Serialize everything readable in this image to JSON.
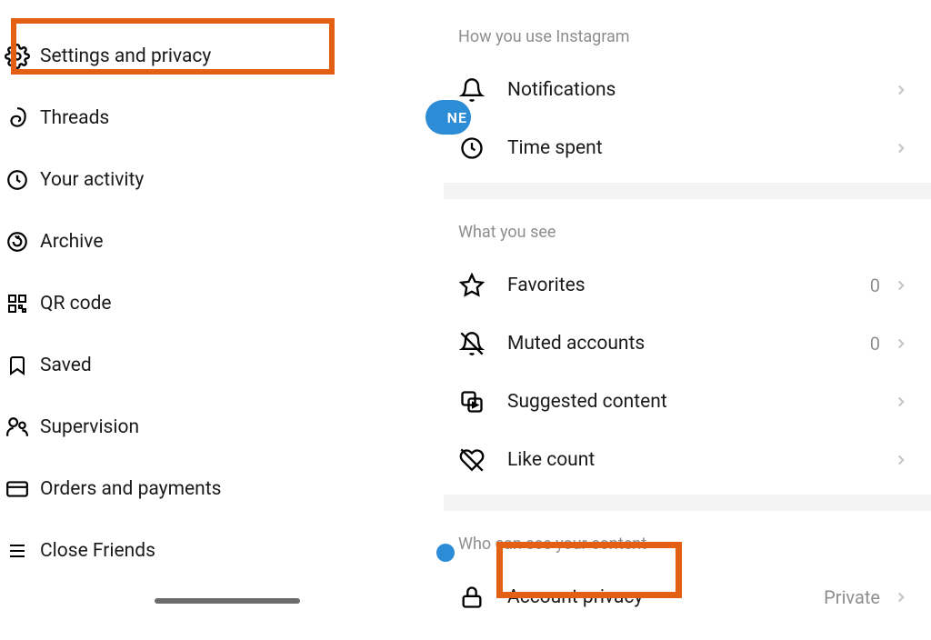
{
  "left_menu": {
    "settings_privacy": "Settings and privacy",
    "threads": "Threads",
    "your_activity": "Your activity",
    "archive": "Archive",
    "qr_code": "QR code",
    "saved": "Saved",
    "supervision": "Supervision",
    "orders_payments": "Orders and payments",
    "close_friends": "Close Friends"
  },
  "badge_new": "NE",
  "right_panel": {
    "section1_header": "How you use Instagram",
    "notifications": "Notifications",
    "time_spent": "Time spent",
    "section2_header": "What you see",
    "favorites": "Favorites",
    "favorites_count": "0",
    "muted_accounts": "Muted accounts",
    "muted_count": "0",
    "suggested_content": "Suggested content",
    "like_count": "Like count",
    "section3_header": "Who can see your content",
    "account_privacy": "Account privacy",
    "account_privacy_value": "Private"
  }
}
